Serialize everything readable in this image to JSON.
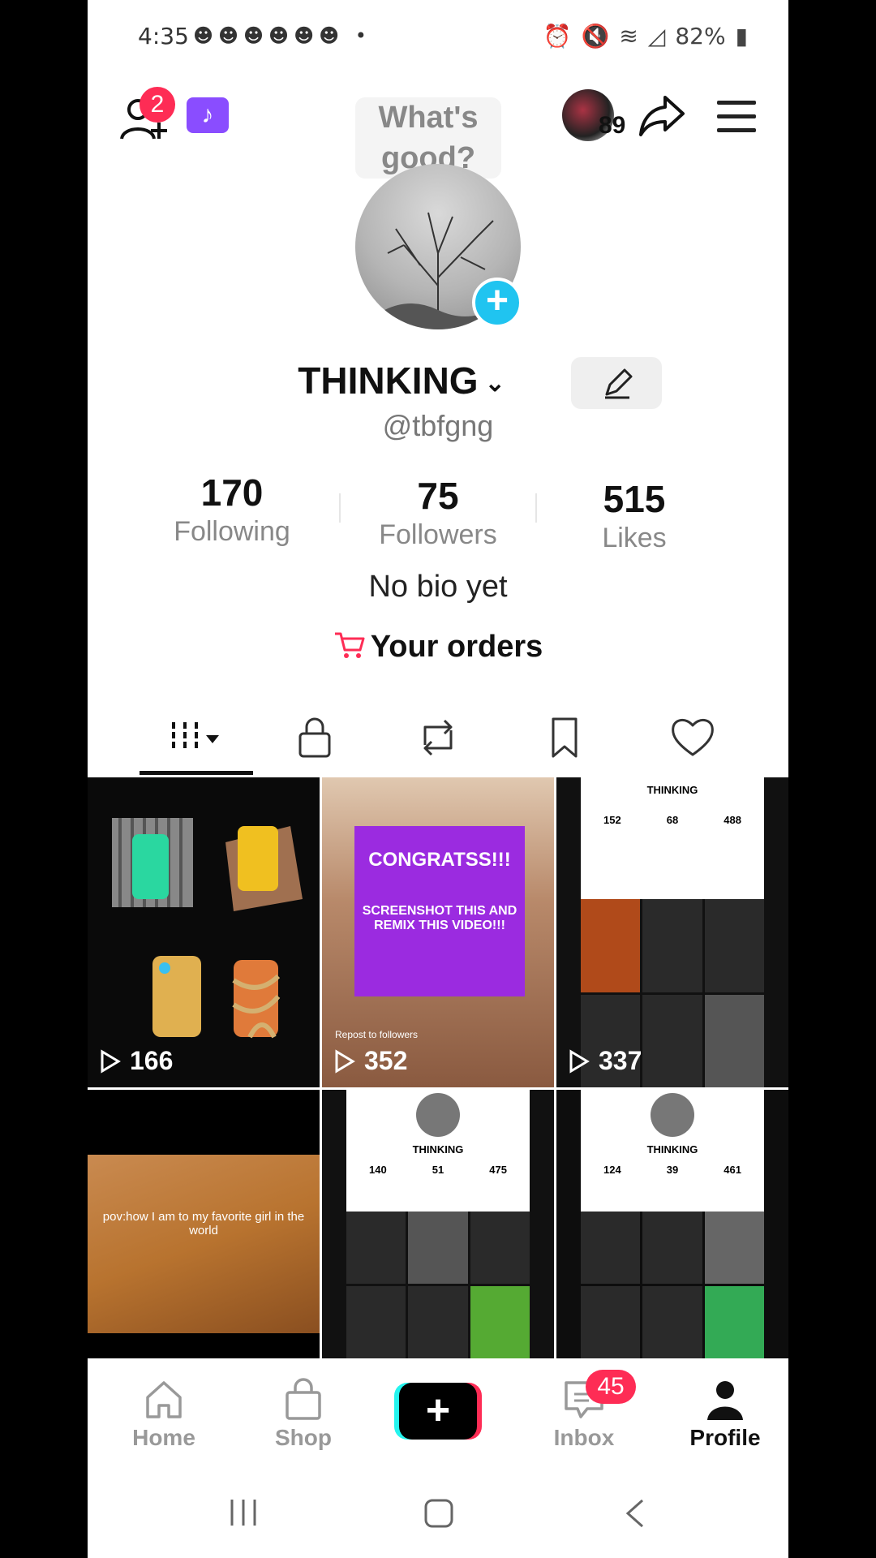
{
  "status_bar": {
    "time": "4:35",
    "notif_icons": "☻☻☻☻☻☻ •",
    "battery": "82%"
  },
  "top_bar": {
    "friend_request_count": "2",
    "speech_bubble": "What's good?",
    "story_count": "89"
  },
  "profile": {
    "display_name": "THINKING",
    "username": "@tbfgng",
    "stats": [
      {
        "value": "170",
        "label": "Following"
      },
      {
        "value": "75",
        "label": "Followers"
      },
      {
        "value": "515",
        "label": "Likes"
      }
    ],
    "bio": "No bio yet",
    "orders_label": "Your orders"
  },
  "tabs": [
    "videos-icon",
    "lock-icon",
    "repost-icon",
    "bookmark-icon",
    "heart-icon"
  ],
  "videos": [
    {
      "views": "166"
    },
    {
      "views": "352",
      "overlay_title": "CONGRATSS!!!",
      "overlay_text": "SCREENSHOT THIS AND REMIX THIS VIDEO!!!",
      "repost_text": "Repost to followers"
    },
    {
      "views": "337",
      "mini_name": "THINKING",
      "mini_stats": [
        "152",
        "68",
        "488"
      ]
    },
    {
      "caption": "pov:how I am to my favorite girl in the world"
    },
    {
      "mini_name": "THINKING",
      "mini_stats": [
        "140",
        "51",
        "475"
      ]
    },
    {
      "mini_name": "THINKING",
      "mini_stats": [
        "124",
        "39",
        "461"
      ]
    }
  ],
  "bottom_nav": {
    "home": "Home",
    "shop": "Shop",
    "inbox": "Inbox",
    "inbox_count": "45",
    "profile": "Profile"
  },
  "colors": {
    "accent_red": "#fe2c55",
    "accent_cyan": "#25f4ee",
    "avatar_plus": "#20c4f0"
  }
}
